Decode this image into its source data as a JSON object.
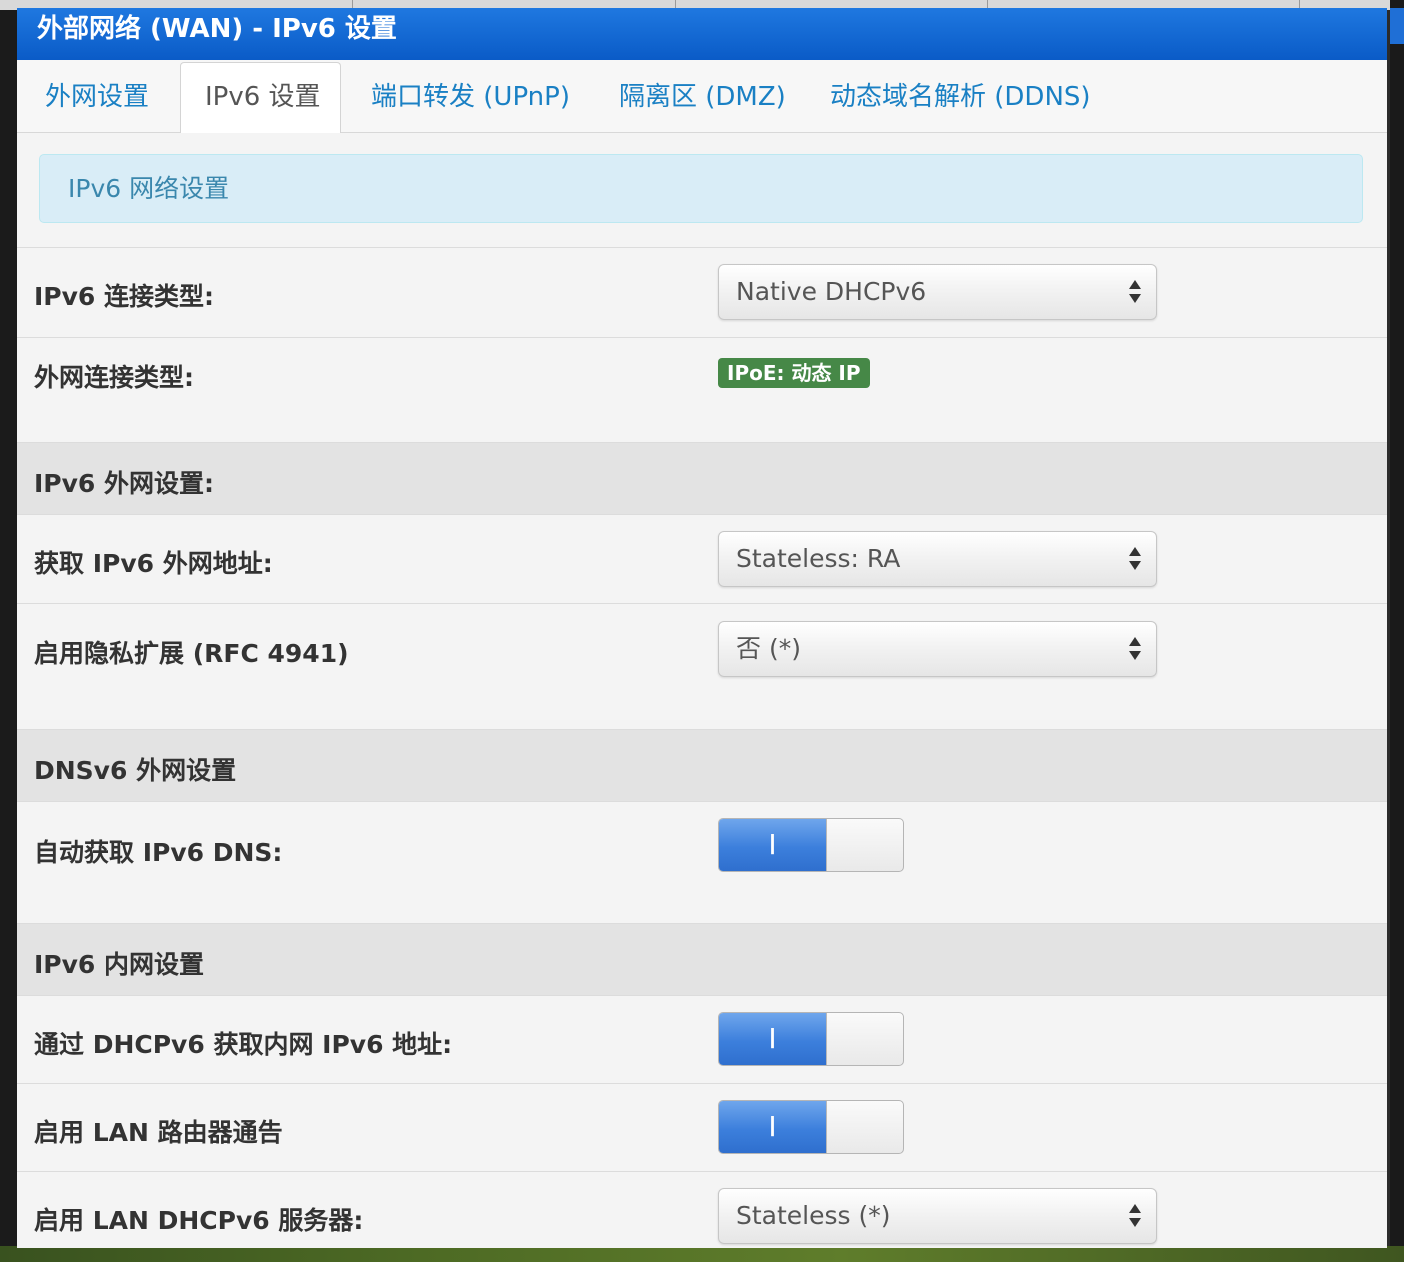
{
  "header": {
    "title": "外部网络 (WAN) - IPv6 设置"
  },
  "tabs": [
    {
      "label": "外网设置",
      "active": false
    },
    {
      "label": "IPv6 设置",
      "active": true
    },
    {
      "label": "端口转发 (UPnP)",
      "active": false
    },
    {
      "label": "隔离区 (DMZ)",
      "active": false
    },
    {
      "label": "动态域名解析 (DDNS)",
      "active": false
    }
  ],
  "info_box": {
    "text": "IPv6 网络设置"
  },
  "rows": {
    "connection_type": {
      "label": "IPv6 连接类型:",
      "value": "Native DHCPv6"
    },
    "wan_connection_type": {
      "label": "外网连接类型:",
      "badge": "IPoE: 动态 IP"
    },
    "section_wan": {
      "label": "IPv6 外网设置:"
    },
    "get_wan_address": {
      "label": "获取 IPv6 外网地址:",
      "value": "Stateless: RA"
    },
    "privacy_ext": {
      "label": "启用隐私扩展 (RFC 4941)",
      "value": "否 (*)"
    },
    "section_dns": {
      "label": "DNSv6 外网设置"
    },
    "auto_dns": {
      "label": "自动获取 IPv6 DNS:",
      "toggle_label": "I",
      "state": "on"
    },
    "section_lan": {
      "label": "IPv6 内网设置"
    },
    "dhcpv6_lan": {
      "label": "通过 DHCPv6 获取内网 IPv6 地址:",
      "toggle_label": "I",
      "state": "on"
    },
    "lan_ra": {
      "label": "启用 LAN 路由器通告",
      "toggle_label": "I",
      "state": "on"
    },
    "lan_dhcpv6_server": {
      "label": "启用 LAN DHCPv6 服务器:",
      "value": "Stateless (*)"
    }
  },
  "colors": {
    "title_bar": "#0a5bc7",
    "tab_link": "#1a80c4",
    "info_bg": "#d9edf7",
    "info_text": "#3a87ad",
    "badge_bg": "#468847",
    "toggle_on": "#3c7fdc"
  }
}
